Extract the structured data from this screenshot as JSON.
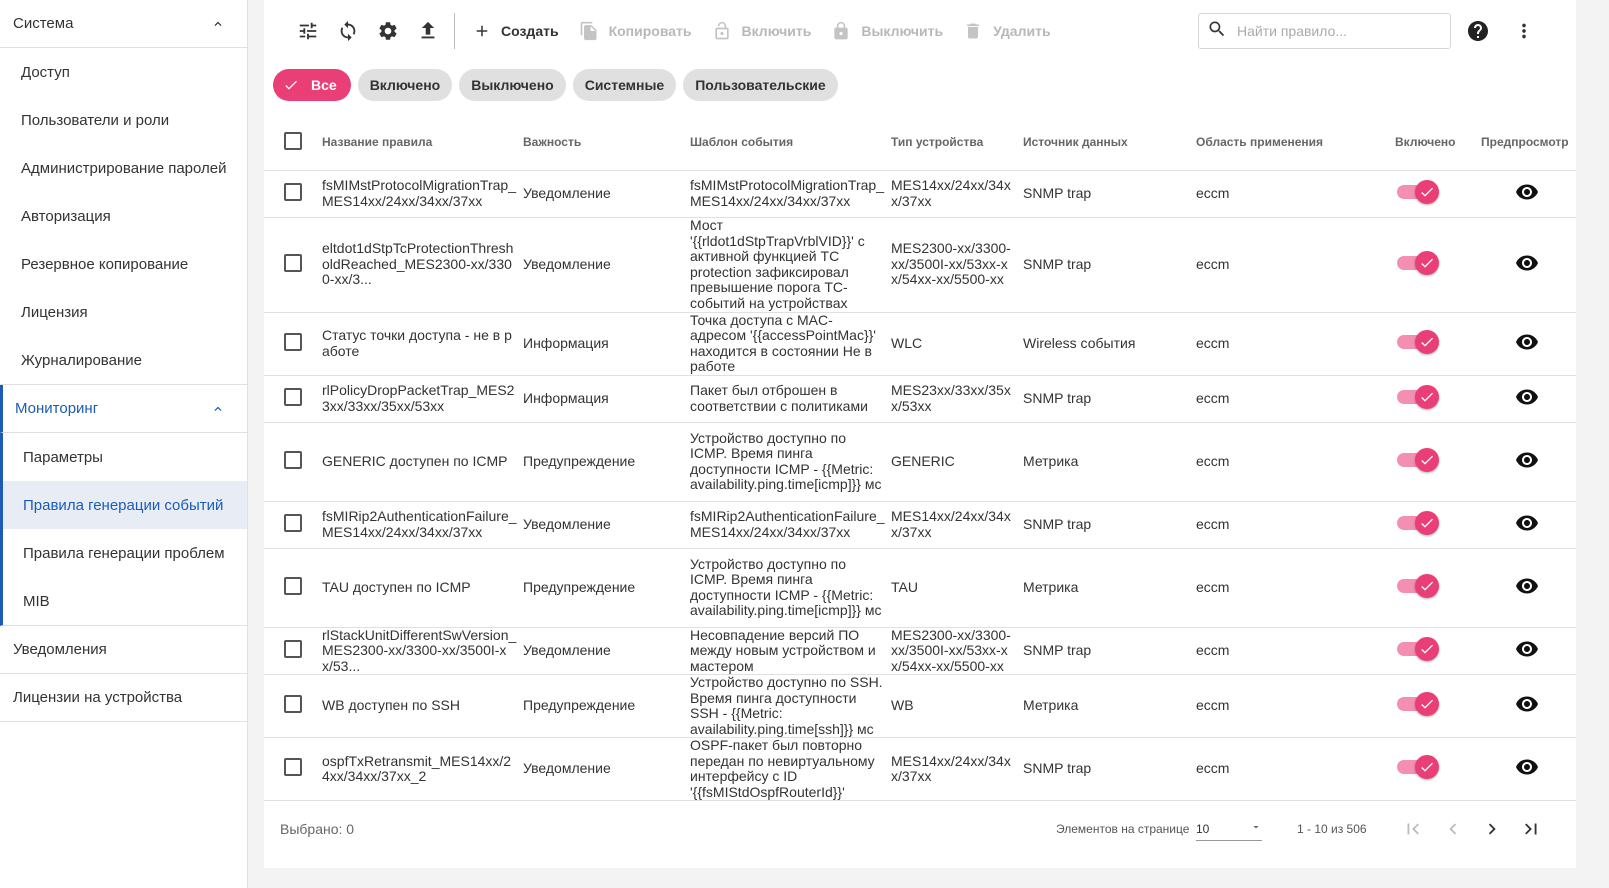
{
  "sidebar": {
    "groups": [
      {
        "label": "Система",
        "expanded": true,
        "items": [
          "Доступ",
          "Пользователи и роли",
          "Администрирование паролей",
          "Авторизация",
          "Резервное копирование",
          "Лицензия",
          "Журналирование"
        ]
      },
      {
        "label": "Мониторинг",
        "expanded": true,
        "items": [
          "Параметры",
          "Правила генерации событий",
          "Правила генерации проблем",
          "MIB"
        ],
        "selected_index": 1
      },
      {
        "label": "Уведомления"
      },
      {
        "label": "Лицензии на устройства"
      }
    ]
  },
  "toolbar": {
    "icons": [
      "tune-icon",
      "refresh-icon",
      "settings-icon",
      "upload-icon"
    ],
    "create_label": "Создать",
    "copy_label": "Копировать",
    "enable_label": "Включить",
    "disable_label": "Выключить",
    "delete_label": "Удалить",
    "search_placeholder": "Найти правило..."
  },
  "filters": {
    "chips": [
      "Все",
      "Включено",
      "Выключено",
      "Системные",
      "Пользовательские"
    ],
    "active_index": 0
  },
  "table": {
    "columns": [
      "Название правила",
      "Важность",
      "Шаблон события",
      "Тип устройства",
      "Источник данных",
      "Область применения",
      "Включено",
      "Предпросмотр"
    ],
    "rows": [
      {
        "name": "fsMIMstProtocolMigrationTrap_MES14xx/24xx/34xx/37xx",
        "severity": "Уведомление",
        "template": "fsMIMstProtocolMigrationTrap_MES14xx/24xx/34xx/37xx",
        "device": "MES14xx/24xx/34xx/37xx",
        "source": "SNMP trap",
        "scope": "eccm",
        "enabled": true
      },
      {
        "name": "eltdot1dStpTcProtectionThresholdReached_MES2300-xx/3300-xx/3...",
        "severity": "Уведомление",
        "template": "Мост '{{rldot1dStpTrapVrblVID}}' с активной функцией TC protection зафиксировал превышение порога TC-событий на устройствах",
        "device": "MES2300-xx/3300-xx/3500I-xx/53xx-xx/54xx-xx/5500-xx",
        "source": "SNMP trap",
        "scope": "eccm",
        "enabled": true
      },
      {
        "name": "Статус точки доступа - не в работе",
        "severity": "Информация",
        "template": "Точка доступа с MAC-адресом '{{accessPointMac}}' находится в состоянии Не в работе",
        "device": "WLC",
        "source": "Wireless события",
        "scope": "eccm",
        "enabled": true
      },
      {
        "name": "rlPolicyDropPacketTrap_MES23xx/33xx/35xx/53xx",
        "severity": "Информация",
        "template": "Пакет был отброшен в соответствии с политиками",
        "device": "MES23xx/33xx/35xx/53xx",
        "source": "SNMP trap",
        "scope": "eccm",
        "enabled": true
      },
      {
        "name": "GENERIC доступен по ICMP",
        "severity": "Предупреждение",
        "template": "Устройство доступно по ICMP. Время пинга доступности ICMP - {{Metric: availability.ping.time[icmp]}} мс",
        "device": "GENERIC",
        "source": "Метрика",
        "scope": "eccm",
        "enabled": true
      },
      {
        "name": "fsMIRip2AuthenticationFailure_MES14xx/24xx/34xx/37xx",
        "severity": "Уведомление",
        "template": "fsMIRip2AuthenticationFailure_MES14xx/24xx/34xx/37xx",
        "device": "MES14xx/24xx/34xx/37xx",
        "source": "SNMP trap",
        "scope": "eccm",
        "enabled": true
      },
      {
        "name": "TAU доступен по ICMP",
        "severity": "Предупреждение",
        "template": "Устройство доступно по ICMP. Время пинга доступности ICMP - {{Metric: availability.ping.time[icmp]}} мс",
        "device": "TAU",
        "source": "Метрика",
        "scope": "eccm",
        "enabled": true
      },
      {
        "name": "rlStackUnitDifferentSwVersion_MES2300-xx/3300-xx/3500I-xx/53...",
        "severity": "Уведомление",
        "template": "Несовпадение версий ПО между новым устройством и мастером",
        "device": "MES2300-xx/3300-xx/3500I-xx/53xx-xx/54xx-xx/5500-xx",
        "source": "SNMP trap",
        "scope": "eccm",
        "enabled": true
      },
      {
        "name": "WB доступен по SSH",
        "severity": "Предупреждение",
        "template": "Устройство доступно по SSH. Время пинга доступности SSH - {{Metric: availability.ping.time[ssh]}} мс",
        "device": "WB",
        "source": "Метрика",
        "scope": "eccm",
        "enabled": true
      },
      {
        "name": "ospfTxRetransmit_MES14xx/24xx/34xx/37xx_2",
        "severity": "Уведомление",
        "template": "OSPF-пакет был повторно передан по невиртуальному интерфейсу с ID '{{fsMIStdOspfRouterId}}'",
        "device": "MES14xx/24xx/34xx/37xx",
        "source": "SNMP trap",
        "scope": "eccm",
        "enabled": true
      }
    ]
  },
  "footer": {
    "selected_label": "Выбрано: 0",
    "per_page_label": "Элементов на странице",
    "per_page_value": "10",
    "range_label": "1 - 10 из 506"
  },
  "colors": {
    "accent": "#ea3f76",
    "nav_active": "#1c5bb8"
  }
}
